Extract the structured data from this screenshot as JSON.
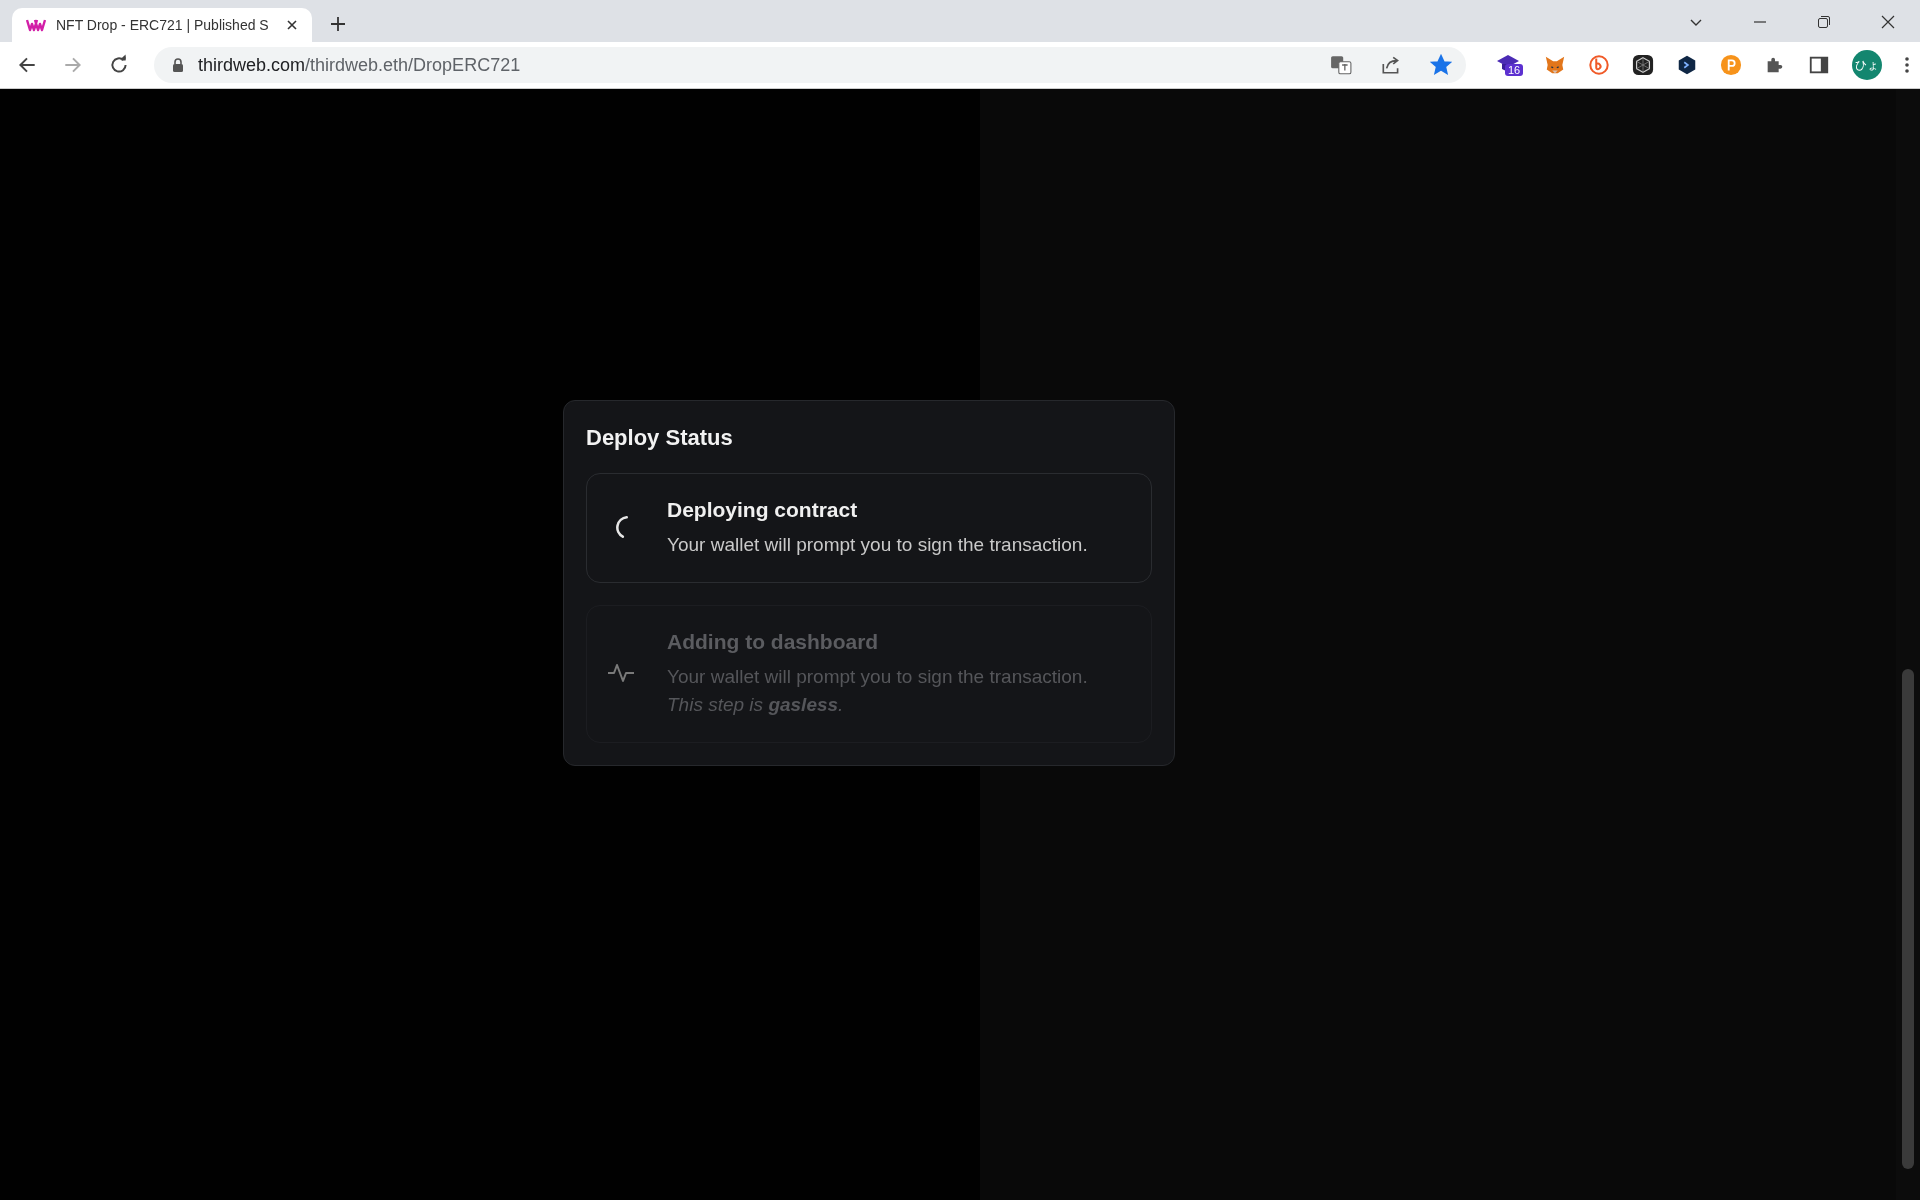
{
  "browser": {
    "tab": {
      "title": "NFT Drop - ERC721 | Published S",
      "selected": true
    },
    "address": {
      "host": "thirdweb.com",
      "path": "/thirdweb.eth/DropERC721"
    },
    "bookmarked": true,
    "extensions": [
      {
        "kind": "graduation",
        "badge": "16"
      },
      {
        "kind": "fox"
      },
      {
        "kind": "b-circle"
      },
      {
        "kind": "hexagon"
      },
      {
        "kind": "shield"
      },
      {
        "kind": "p-circle"
      },
      {
        "kind": "puzzle"
      },
      {
        "kind": "panel"
      }
    ],
    "profile": {
      "initials": "ひょ"
    }
  },
  "modal": {
    "title": "Deploy Status",
    "steps": [
      {
        "title": "Deploying contract",
        "active": true,
        "description": "Your wallet will prompt you to sign the transaction."
      },
      {
        "title": "Adding to dashboard",
        "active": false,
        "description": "Your wallet will prompt you to sign the transaction.",
        "note": "This step is **gasless**."
      }
    ]
  }
}
